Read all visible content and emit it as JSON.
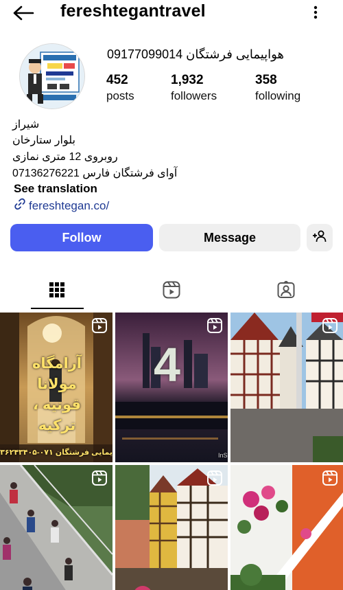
{
  "header": {
    "username": "fereshtegantravel",
    "back_icon": "arrow-left-icon",
    "menu_icon": "more-vertical-icon"
  },
  "profile": {
    "display_name": "هواپیمایی فرشتگان  09177099014",
    "stats": [
      {
        "value": "452",
        "label": "posts"
      },
      {
        "value": "1,932",
        "label": "followers"
      },
      {
        "value": "358",
        "label": "following"
      }
    ],
    "bio_lines": [
      "شیراز",
      "بلوار ستارخان",
      "روبروی 12 متری نمازی",
      "آوای فرشتگان فارس 07136276221"
    ],
    "see_translation": "See translation",
    "link": "fereshtegan.co/"
  },
  "actions": {
    "follow": "Follow",
    "message": "Message",
    "add_user_icon": "person-add-icon"
  },
  "tabs": [
    {
      "name": "grid",
      "icon": "grid-icon",
      "active": true
    },
    {
      "name": "reels",
      "icon": "reels-icon",
      "active": false
    },
    {
      "name": "tagged",
      "icon": "tagged-person-icon",
      "active": false
    }
  ],
  "posts": [
    {
      "overlay_lines": [
        "آرامگاه مولانا",
        "قونیه ، ترکیه"
      ],
      "footer": "یمایی فرشتگان ۰۷۱-۳۶۲۴۳۴۰۵",
      "reel": true
    },
    {
      "overlay_lines": [
        "4"
      ],
      "footer": "InS",
      "reel": true
    },
    {
      "overlay_lines": [],
      "footer": "",
      "reel": true
    },
    {
      "overlay_lines": [],
      "footer": "",
      "reel": true
    },
    {
      "overlay_lines": [],
      "footer": "",
      "reel": true
    },
    {
      "overlay_lines": [],
      "footer": "",
      "reel": true
    }
  ],
  "colors": {
    "follow_bg": "#4a5ef0",
    "secondary_btn_bg": "#efefef",
    "link": "#1f3a93"
  }
}
